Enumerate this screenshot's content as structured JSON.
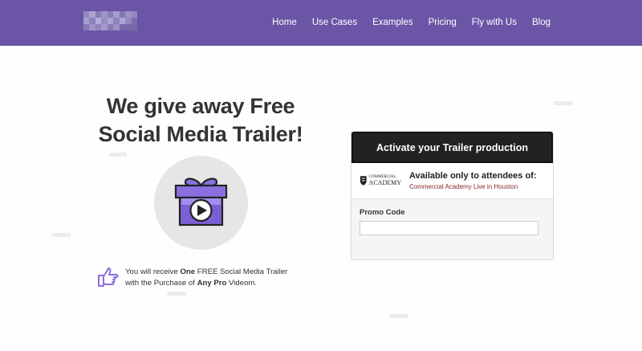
{
  "nav": {
    "items": [
      "Home",
      "Use Cases",
      "Examples",
      "Pricing",
      "Fly with Us",
      "Blog"
    ]
  },
  "hero": {
    "headline_line1": "We give away Free",
    "headline_line2": "Social Media Trailer!",
    "note_prefix": "You will receive ",
    "note_bold1": "One",
    "note_mid": " FREE Social Media Trailer",
    "note_line2_prefix": "with the Purchase of ",
    "note_bold2": "Any Pro",
    "note_suffix": " Videom."
  },
  "card": {
    "title": "Activate your Trailer production",
    "logo_small": "COMMERCIAL",
    "logo_big": "ACADEMY",
    "attend_title": "Available only to attendees of:",
    "attend_event": "Commercial Academy Live in Houston",
    "promo_label": "Promo Code",
    "promo_value": ""
  },
  "colors": {
    "nav_bg": "#6b55a6",
    "accent_purple": "#8b6fe0",
    "event_text": "#8b2a2a"
  },
  "icons": [
    "gift-play-icon",
    "pointing-hand-icon",
    "crest-icon"
  ]
}
